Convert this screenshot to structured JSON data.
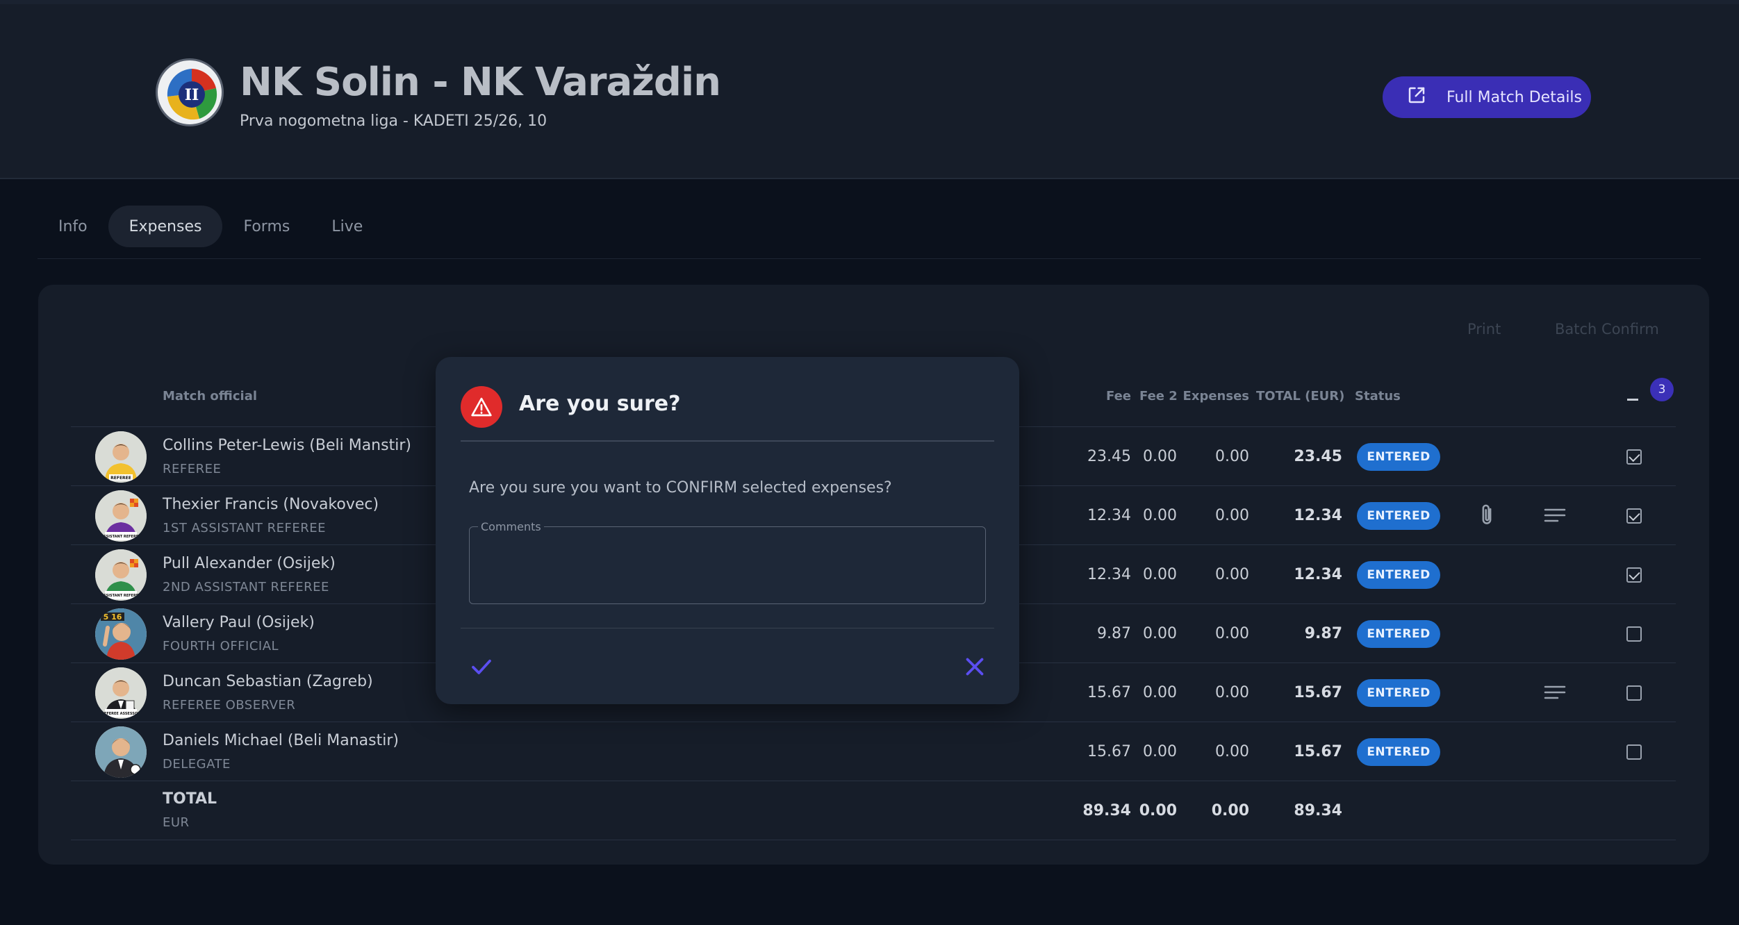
{
  "header": {
    "title": "NK Solin - NK Varaždin",
    "subtitle": "Prva nogometna liga - KADETI 25/26, 10",
    "full_details_label": "Full Match Details",
    "logo_text": "II"
  },
  "tabs": [
    {
      "label": "Info"
    },
    {
      "label": "Expenses",
      "active": true
    },
    {
      "label": "Forms"
    },
    {
      "label": "Live"
    }
  ],
  "toolbar": {
    "print_label": "Print",
    "batch_confirm_label": "Batch Confirm"
  },
  "table": {
    "columns": {
      "official": "Match official",
      "fee": "Fee",
      "fee2": "Fee 2",
      "expenses": "Expenses",
      "total": "TOTAL (EUR)",
      "status": "Status"
    },
    "selected_count": "3",
    "rows": [
      {
        "name": "Collins Peter-Lewis (Beli Manstir)",
        "role": "REFEREE",
        "fee": "23.45",
        "fee2": "0.00",
        "expenses": "0.00",
        "total": "23.45",
        "status": "ENTERED",
        "checked": true,
        "attachment": false,
        "notes": false,
        "avatar_label": "REFEREE"
      },
      {
        "name": "Thexier Francis (Novakovec)",
        "role": "1ST ASSISTANT REFEREE",
        "fee": "12.34",
        "fee2": "0.00",
        "expenses": "0.00",
        "total": "12.34",
        "status": "ENTERED",
        "checked": true,
        "attachment": true,
        "notes": true,
        "avatar_label": "ASSISTANT REFEREE"
      },
      {
        "name": "Pull Alexander (Osijek)",
        "role": "2ND ASSISTANT REFEREE",
        "fee": "12.34",
        "fee2": "0.00",
        "expenses": "0.00",
        "total": "12.34",
        "status": "ENTERED",
        "checked": true,
        "attachment": false,
        "notes": false,
        "avatar_label": "ASSISTANT REFEREE"
      },
      {
        "name": "Vallery Paul (Osijek)",
        "role": "FOURTH OFFICIAL",
        "fee": "9.87",
        "fee2": "0.00",
        "expenses": "0.00",
        "total": "9.87",
        "status": "ENTERED",
        "checked": false,
        "attachment": false,
        "notes": false,
        "avatar_label": "5 16"
      },
      {
        "name": "Duncan Sebastian (Zagreb)",
        "role": "REFEREE OBSERVER",
        "fee": "15.67",
        "fee2": "0.00",
        "expenses": "0.00",
        "total": "15.67",
        "status": "ENTERED",
        "checked": false,
        "attachment": false,
        "notes": true,
        "avatar_label": "REFEREE ASSESSOR"
      },
      {
        "name": "Daniels Michael (Beli Manastir)",
        "role": "DELEGATE",
        "fee": "15.67",
        "fee2": "0.00",
        "expenses": "0.00",
        "total": "15.67",
        "status": "ENTERED",
        "checked": false,
        "attachment": false,
        "notes": false,
        "avatar_label": ""
      }
    ],
    "totals": {
      "label": "TOTAL",
      "currency": "EUR",
      "fee": "89.34",
      "fee2": "0.00",
      "expenses": "0.00",
      "total": "89.34"
    }
  },
  "dialog": {
    "title": "Are you sure?",
    "message": "Are you sure you want to CONFIRM selected expenses?",
    "comments_label": "Comments",
    "comments_value": ""
  },
  "colors": {
    "accent": "#3a2eb5",
    "status_entered": "#1f6fcf",
    "warning": "#e02b2b",
    "background": "#0b111c",
    "panel": "#161d29"
  }
}
